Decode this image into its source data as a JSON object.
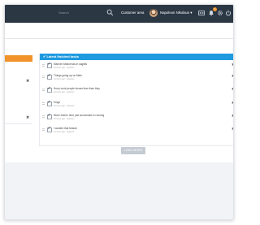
{
  "topbar": {
    "search_placeholder": "Search",
    "customer_area": "Customer area",
    "user_name": "Napoleon Nikolaus",
    "user_caret": "▾",
    "notification_count": "3",
    "icons": [
      "search-icon",
      "id-card-icon",
      "bell-icon",
      "gear-icon",
      "power-icon"
    ]
  },
  "tasks_panel": {
    "header_label": "✔ Latest finished tasks",
    "items": [
      {
        "title": "Maecen Maecenas in sagittis",
        "meta": "20 hours ago · Aquarius",
        "check": "✔",
        "delete": "✖"
      },
      {
        "title": "Things going up on Main",
        "meta": "20 hours ago · Aquarius",
        "check": "✔",
        "delete": "✖"
      },
      {
        "title": "Hurry work people knows than than they",
        "meta": "20 hours ago · Aquarius",
        "check": "✔",
        "delete": "✖"
      },
      {
        "title": "Kings",
        "meta": "20 hours ago · Aquarius",
        "check": "✔",
        "delete": "✖"
      },
      {
        "title": "Move further here just succeeded in running",
        "meta": "20 hours ago · Aquarius",
        "check": "✔",
        "delete": "✖"
      },
      {
        "title": "I wanted that feature",
        "meta": "20 hours ago · Aquarius",
        "check": "✔",
        "delete": "✖"
      }
    ]
  },
  "left_panel": {
    "delete_1": "✖",
    "delete_2": "✖"
  },
  "load_more_label": "LOAD MORE",
  "colors": {
    "topbar": "#2c3744",
    "accent_blue": "#1f9ae0",
    "accent_orange": "#f0932b"
  }
}
